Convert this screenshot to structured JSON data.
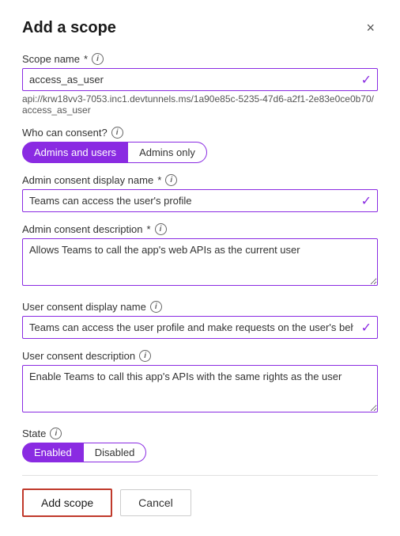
{
  "dialog": {
    "title": "Add a scope",
    "close_label": "×"
  },
  "scope_name": {
    "label": "Scope name",
    "required": "*",
    "value": "access_as_user",
    "api_url": "api://krw18vv3-7053.inc1.devtunnels.ms/1a90e85c-5235-47d6-a2f1-2e83e0ce0b70/access_as_user"
  },
  "who_can_consent": {
    "label": "Who can consent?",
    "options": [
      {
        "label": "Admins and users",
        "active": true
      },
      {
        "label": "Admins only",
        "active": false
      }
    ]
  },
  "admin_consent_display_name": {
    "label": "Admin consent display name",
    "required": "*",
    "value": "Teams can access the user's profile"
  },
  "admin_consent_description": {
    "label": "Admin consent description",
    "required": "*",
    "value": "Allows Teams to call the app's web APIs as the current user"
  },
  "user_consent_display_name": {
    "label": "User consent display name",
    "value": "Teams can access the user profile and make requests on the user's behalf"
  },
  "user_consent_description": {
    "label": "User consent description",
    "value": "Enable Teams to call this app's APIs with the same rights as the user"
  },
  "state": {
    "label": "State",
    "options": [
      {
        "label": "Enabled",
        "active": true
      },
      {
        "label": "Disabled",
        "active": false
      }
    ]
  },
  "footer": {
    "add_scope_label": "Add scope",
    "cancel_label": "Cancel"
  },
  "icons": {
    "info": "i",
    "check": "✓",
    "close": "×"
  }
}
